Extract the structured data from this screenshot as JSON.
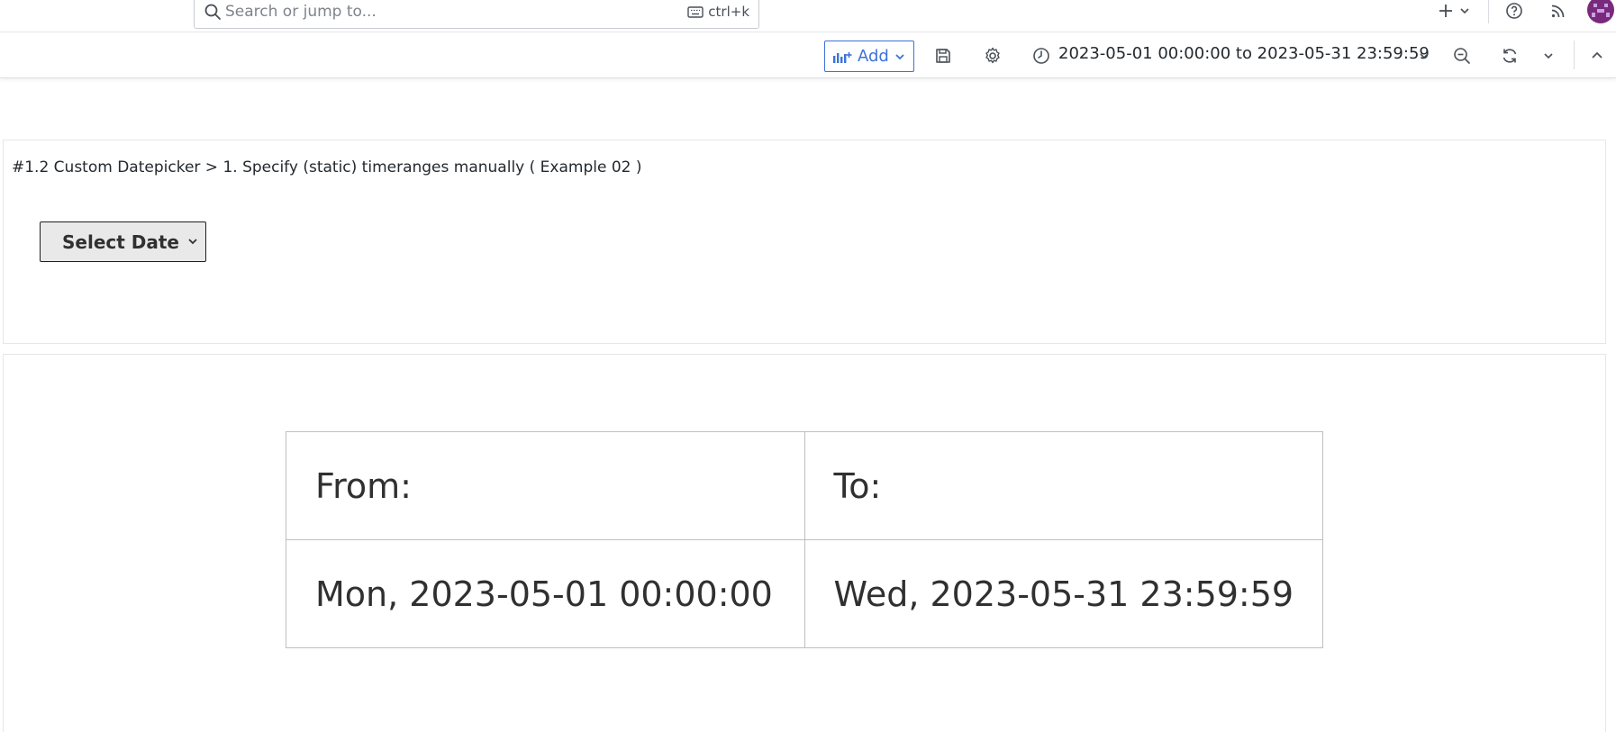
{
  "search": {
    "placeholder": "Search or jump to...",
    "shortcut": "ctrl+k"
  },
  "topbar": {
    "icons": [
      "plus-icon",
      "chevron-down-icon",
      "help-icon",
      "rss-icon",
      "avatar"
    ]
  },
  "toolbar": {
    "add_label": "Add",
    "time_range": "2023-05-01 00:00:00 to 2023-05-31 23:59:59"
  },
  "panel1": {
    "title": "#1.2 Custom Datepicker > 1. Specify (static) timeranges manually ( Example 02 )",
    "select_label": "Select Date"
  },
  "panel2": {
    "from_header": "From:",
    "to_header": "To:",
    "from_value": "Mon, 2023-05-01 00:00:00",
    "to_value": "Wed, 2023-05-31 23:59:59"
  },
  "colors": {
    "accent": "#3d71d9",
    "avatar_bg": "#7a2a7a"
  }
}
